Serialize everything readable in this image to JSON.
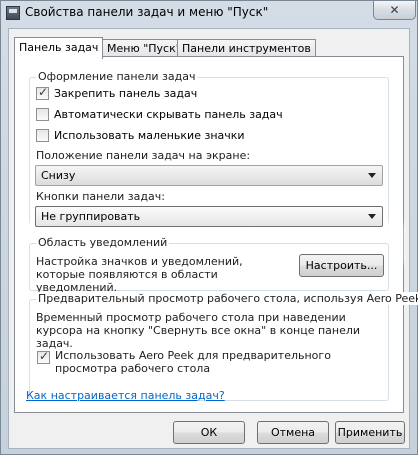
{
  "window": {
    "title": "Свойства панели задач и меню \"Пуск\"",
    "close_label": "✕"
  },
  "tabs": [
    {
      "label": "Панель задач",
      "active": true
    },
    {
      "label": "Меню \"Пуск\"",
      "active": false
    },
    {
      "label": "Панели инструментов",
      "active": false
    }
  ],
  "appearance": {
    "group_label": "Оформление панели задач",
    "options": [
      {
        "label": "Закрепить панель задач",
        "checked": true
      },
      {
        "label": "Автоматически скрывать панель задач",
        "checked": false
      },
      {
        "label": "Использовать маленькие значки",
        "checked": false
      }
    ],
    "position_label": "Положение панели задач на экране:",
    "position_value": "Снизу",
    "buttons_label": "Кнопки панели задач:",
    "buttons_value": "Не группировать"
  },
  "notifications": {
    "group_label": "Область уведомлений",
    "description": "Настройка значков и уведомлений, которые появляются в области уведомлений.",
    "configure_label": "Настроить..."
  },
  "aero_peek": {
    "group_label": "Предварительный просмотр рабочего стола, используя Aero Peek",
    "description": "Временный просмотр рабочего стола при наведении курсора на кнопку \"Свернуть все окна\" в конце панели задач.",
    "checkbox_label": "Использовать Aero Peek для предварительного просмотра рабочего стола",
    "checked": true
  },
  "help_link": "Как настраивается панель задач?",
  "footer": {
    "ok_label": "ОК",
    "cancel_label": "Отмена",
    "apply_label": "Применить"
  }
}
